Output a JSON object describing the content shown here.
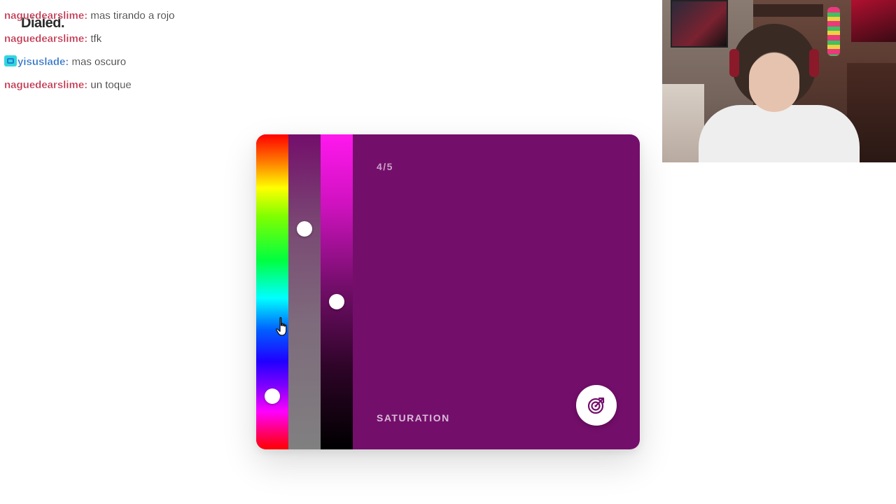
{
  "logo": {
    "text": "Dialed."
  },
  "chat": {
    "messages": [
      {
        "user": "naguedearslime",
        "separator": ":",
        "text": " mas tirando a rojo",
        "user_color": "#c0304a",
        "badge": false
      },
      {
        "user": "naguedearslime",
        "separator": ":",
        "text": " tfk",
        "user_color": "#c0304a",
        "badge": false
      },
      {
        "user": "yisuslade",
        "separator": ":",
        "text": " mas oscuro",
        "user_color": "#2f72c8",
        "badge": true
      },
      {
        "user": "naguedearslime",
        "separator": ":",
        "text": " un toque",
        "user_color": "#c0304a",
        "badge": false
      }
    ]
  },
  "webcam": {
    "icon": "webcam-feed"
  },
  "picker": {
    "step": "4/5",
    "mode_label": "SATURATION",
    "color": "#740e6b",
    "hue_value": 0.83,
    "saturation_value": 0.3,
    "lightness_value": 0.53,
    "submit_icon": "target-arrow-icon"
  },
  "cursor": {
    "icon": "hand-pointer-icon"
  }
}
